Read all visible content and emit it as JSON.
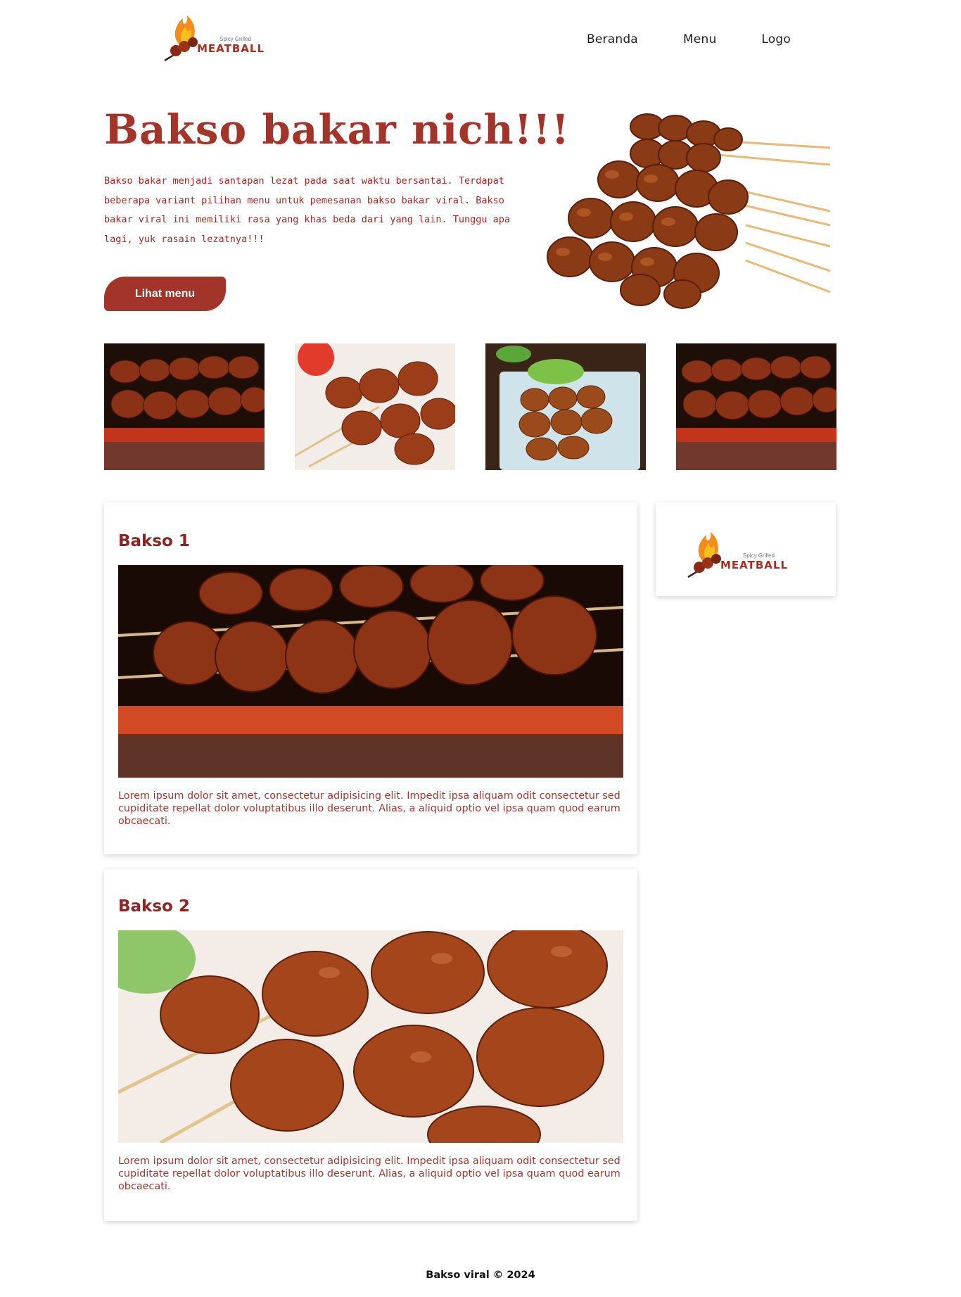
{
  "brand": {
    "tagline": "Spicy Grilled",
    "name": "MEATBALL"
  },
  "nav": {
    "items": [
      "Beranda",
      "Menu",
      "Logo"
    ]
  },
  "hero": {
    "title": "Bakso bakar nich!!!",
    "text": "Bakso bakar menjadi santapan lezat pada saat waktu bersantai. Terdapat beberapa variant pilihan menu untuk pemesanan bakso bakar viral. Bakso bakar viral ini memiliki rasa yang khas beda dari yang lain. Tunggu apa lagi, yuk rasain lezatnya!!!",
    "button_label": "Lihat menu"
  },
  "cards": [
    {
      "title": "Bakso 1",
      "text": "Lorem ipsum dolor sit amet, consectetur adipisicing elit. Impedit ipsa aliquam odit consectetur sed cupiditate repellat dolor voluptatibus illo deserunt. Alias, a aliquid optio vel ipsa quam quod earum obcaecati."
    },
    {
      "title": "Bakso 2",
      "text": "Lorem ipsum dolor sit amet, consectetur adipisicing elit. Impedit ipsa aliquam odit consectetur sed cupiditate repellat dolor voluptatibus illo deserunt. Alias, a aliquid optio vel ipsa quam quod earum obcaecati."
    }
  ],
  "footer": {
    "text": "Bakso viral © 2024"
  },
  "colors": {
    "brand_red": "#a3342a",
    "text_red": "#9c2a23",
    "title_red": "#8f2424"
  }
}
